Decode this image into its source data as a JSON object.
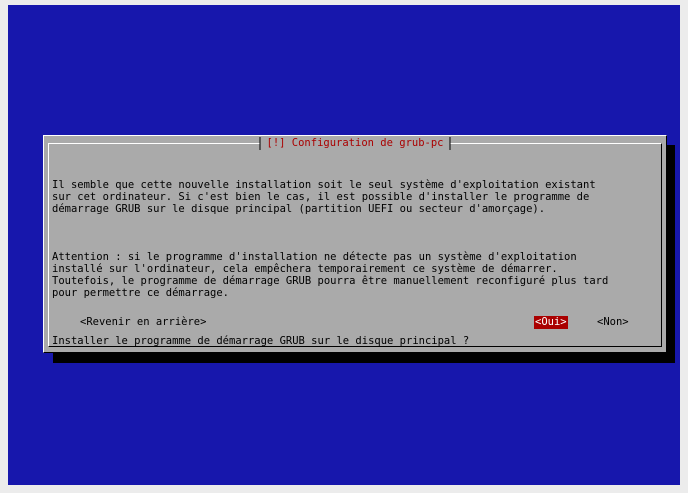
{
  "dialog": {
    "title": "[!] Configuration de grub-pc",
    "paragraphs": [
      "Il semble que cette nouvelle installation soit le seul système d'exploitation existant\nsur cet ordinateur. Si c'est bien le cas, il est possible d'installer le programme de\ndémarrage GRUB sur le disque principal (partition UEFI ou secteur d'amorçage).",
      "Attention : si le programme d'installation ne détecte pas un système d'exploitation\ninstallé sur l'ordinateur, cela empêchera temporairement ce système de démarrer.\nToutefois, le programme de démarrage GRUB pourra être manuellement reconfiguré plus tard\npour permettre ce démarrage.",
      "Installer le programme de démarrage GRUB sur le disque principal ?"
    ],
    "buttons": {
      "back": "<Revenir en arrière>",
      "yes": "<Oui>",
      "no": "<Non>"
    }
  },
  "colors": {
    "background": "#1717ac",
    "dialog": "#aaaaaa",
    "title_text": "#aa0000",
    "selected_button": "#aa0000"
  }
}
